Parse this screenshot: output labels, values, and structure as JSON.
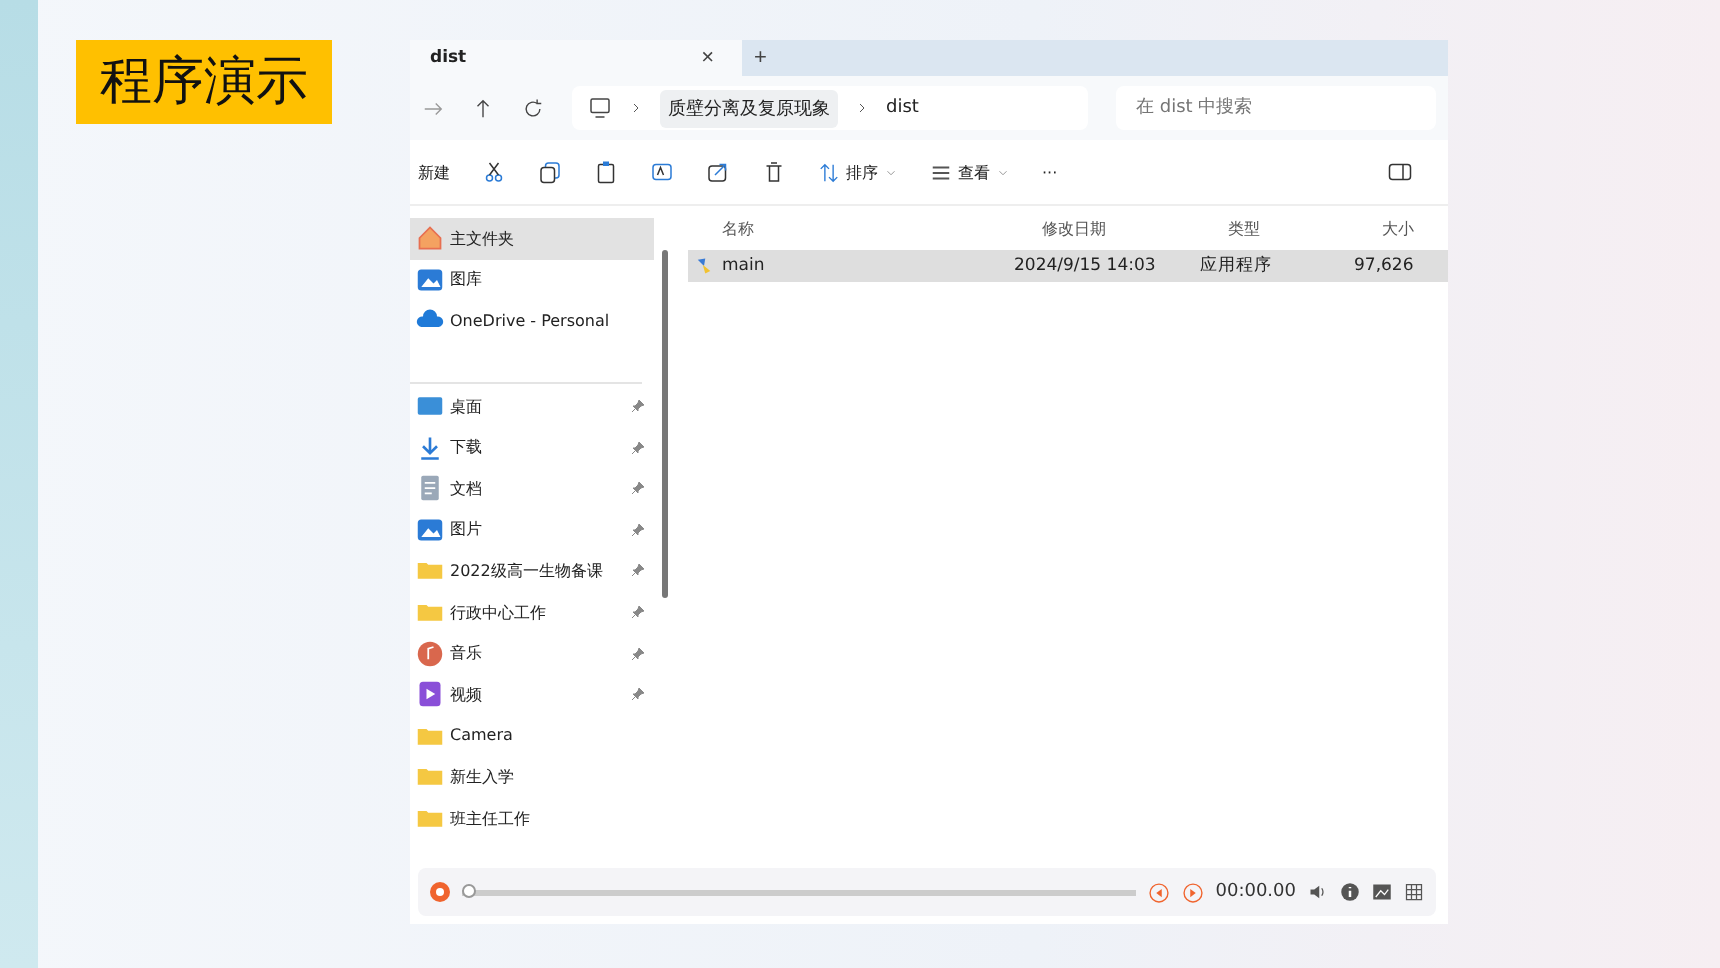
{
  "slide_title": "程序演示",
  "window": {
    "tab": {
      "title": "dist",
      "selected": true
    },
    "tab_close": "×",
    "new_tab": "+"
  },
  "address": {
    "segments": [
      "质壁分离及复原现象",
      "dist"
    ],
    "search_placeholder": "在 dist 中搜索"
  },
  "toolbar": {
    "new": "新建",
    "sort": "排序",
    "view": "查看",
    "more": "···"
  },
  "sidebar": {
    "items": [
      {
        "kind": "home",
        "label": "主文件夹",
        "selected": true,
        "pinned": false
      },
      {
        "kind": "gallery",
        "label": "图库",
        "selected": false,
        "pinned": false
      },
      {
        "kind": "cloud",
        "label": "OneDrive - Personal",
        "selected": false,
        "pinned": false
      },
      {
        "kind": "desktop",
        "label": "桌面",
        "selected": false,
        "pinned": true
      },
      {
        "kind": "download",
        "label": "下载",
        "selected": false,
        "pinned": true
      },
      {
        "kind": "documents",
        "label": "文档",
        "selected": false,
        "pinned": true
      },
      {
        "kind": "pictures",
        "label": "图片",
        "selected": false,
        "pinned": true
      },
      {
        "kind": "folder",
        "label": "2022级高一生物备课",
        "selected": false,
        "pinned": true
      },
      {
        "kind": "folder",
        "label": "行政中心工作",
        "selected": false,
        "pinned": true
      },
      {
        "kind": "music",
        "label": "音乐",
        "selected": false,
        "pinned": true
      },
      {
        "kind": "video",
        "label": "视频",
        "selected": false,
        "pinned": true
      },
      {
        "kind": "folder",
        "label": "Camera",
        "selected": false,
        "pinned": false
      },
      {
        "kind": "folder",
        "label": "新生入学",
        "selected": false,
        "pinned": false
      },
      {
        "kind": "folder",
        "label": "班主任工作",
        "selected": false,
        "pinned": false
      }
    ]
  },
  "table": {
    "columns": [
      "名称",
      "修改日期",
      "类型",
      "大小"
    ],
    "rows": [
      {
        "name": "main",
        "modified": "2024/9/15 14:03",
        "type": "应用程序",
        "size": "97,626",
        "selected": true
      }
    ]
  },
  "player": {
    "level": 0,
    "time": "00:00.00"
  }
}
